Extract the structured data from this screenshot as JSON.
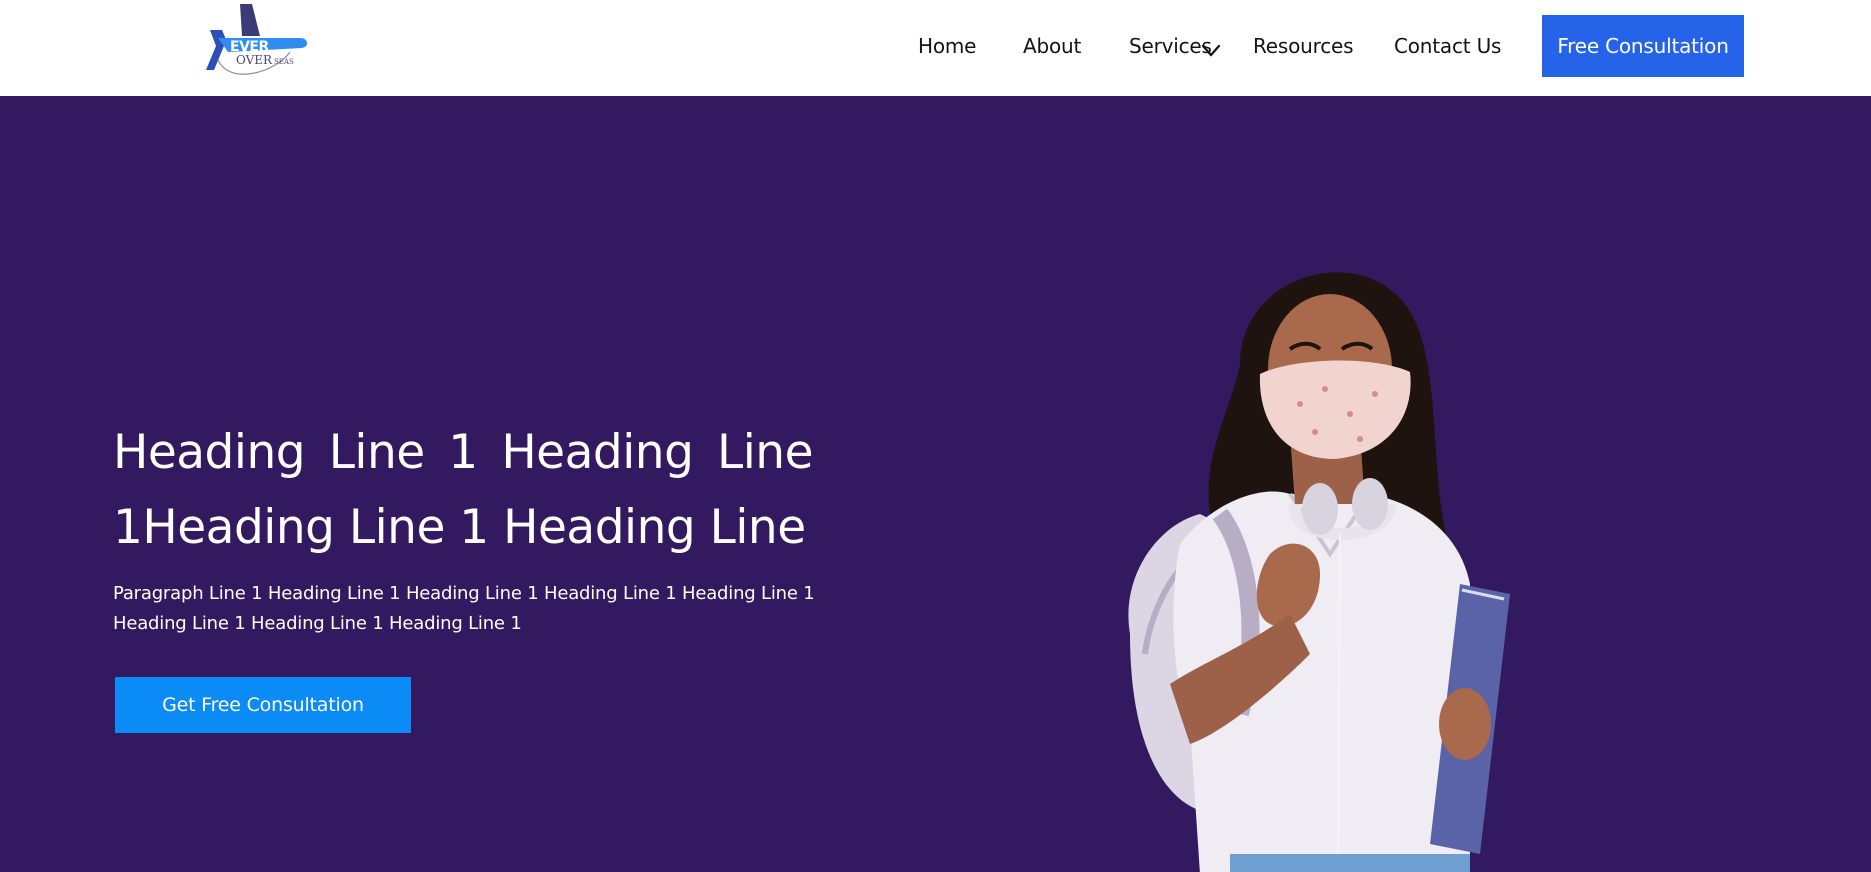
{
  "nav": {
    "logo_text": "EVER OVERSEAS",
    "links": [
      {
        "label": "Home"
      },
      {
        "label": "About"
      },
      {
        "label": "Services"
      },
      {
        "label": "Resources"
      },
      {
        "label": "Contact Us"
      }
    ],
    "services_icon": "chevron-down-icon",
    "cta_label": "Free Consultation"
  },
  "hero": {
    "heading": "Heading Line 1 Heading Line 1Heading Line 1 Heading Line",
    "paragraph": "Paragraph Line 1 Heading Line 1 Heading Line 1 Heading Line 1 Heading Line 1 Heading Line 1 Heading Line 1 Heading Line 1",
    "cta_label": "Get Free Consultation",
    "image": "student-with-mask-and-backpack"
  },
  "colors": {
    "nav_bg": "#ffffff",
    "hero_bg": "#331a60",
    "top_cta_bg": "#2563e9",
    "hero_cta_bg": "#0a8bf5"
  }
}
